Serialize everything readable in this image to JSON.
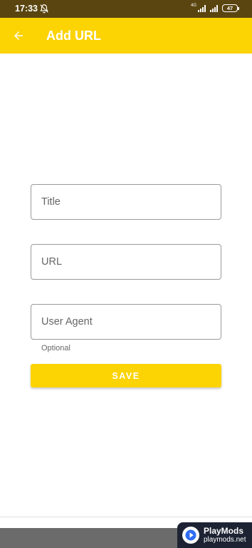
{
  "status_bar": {
    "time": "17:33",
    "network_label": "4G",
    "battery": "47"
  },
  "app_bar": {
    "title": "Add URL",
    "back_icon": "arrow-back-icon",
    "color": "#fcd303"
  },
  "form": {
    "title_field": {
      "placeholder": "Title",
      "value": ""
    },
    "url_field": {
      "placeholder": "URL",
      "value": ""
    },
    "user_agent_field": {
      "placeholder": "User Agent",
      "value": "",
      "helper": "Optional"
    },
    "save_label": "SAVE"
  },
  "watermark": {
    "name": "PlayMods",
    "domain": "playmods.net"
  }
}
